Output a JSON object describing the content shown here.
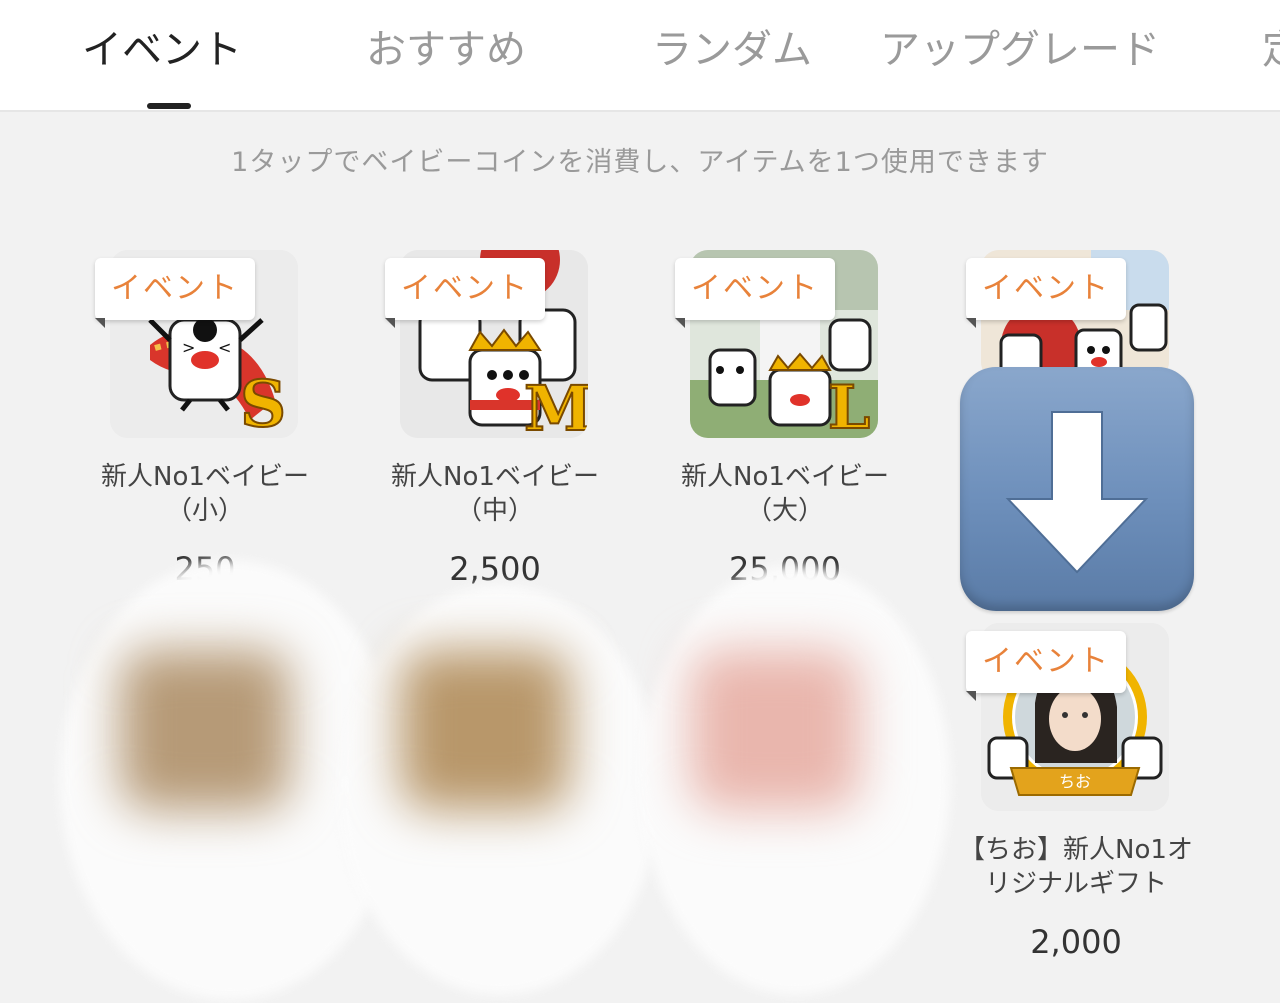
{
  "tabs": [
    {
      "label": "イベント",
      "active": true
    },
    {
      "label": "おすすめ",
      "active": false
    },
    {
      "label": "ランダム",
      "active": false
    },
    {
      "label": "アップグレード",
      "active": false
    },
    {
      "label": "定",
      "active": false
    }
  ],
  "subtitle": "1タップでベイビーコインを消費し、アイテムを1つ使用できます",
  "badge_label": "イベント",
  "items": [
    {
      "name_line1": "新人No1ベイビー",
      "name_line2": "（小）",
      "price": "250",
      "size_letter": "S"
    },
    {
      "name_line1": "新人No1ベイビー",
      "name_line2": "（中）",
      "price": "2,500",
      "size_letter": "M"
    },
    {
      "name_line1": "新人No1ベイビー",
      "name_line2": "（大）",
      "price": "25,000",
      "size_letter": "L"
    },
    {
      "name_line1": "【ちお】新人No1オ",
      "name_line2": "リジナルギフト",
      "price": "2,000",
      "ribbon_text": "ちお"
    }
  ],
  "colors": {
    "badge_text": "#e8823a",
    "arrow_emoji": "#7a98c2",
    "accent_gold": "#f0b400"
  },
  "icons": {
    "arrow_overlay": "down-arrow-emoji"
  }
}
